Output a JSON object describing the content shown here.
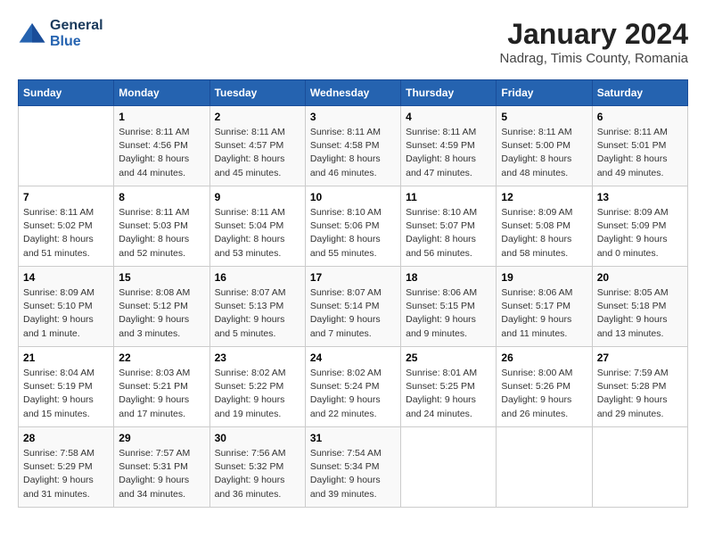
{
  "header": {
    "logo_line1": "General",
    "logo_line2": "Blue",
    "month": "January 2024",
    "location": "Nadrag, Timis County, Romania"
  },
  "weekdays": [
    "Sunday",
    "Monday",
    "Tuesday",
    "Wednesday",
    "Thursday",
    "Friday",
    "Saturday"
  ],
  "weeks": [
    [
      {
        "day": "",
        "sunrise": "",
        "sunset": "",
        "daylight": ""
      },
      {
        "day": "1",
        "sunrise": "Sunrise: 8:11 AM",
        "sunset": "Sunset: 4:56 PM",
        "daylight": "Daylight: 8 hours and 44 minutes."
      },
      {
        "day": "2",
        "sunrise": "Sunrise: 8:11 AM",
        "sunset": "Sunset: 4:57 PM",
        "daylight": "Daylight: 8 hours and 45 minutes."
      },
      {
        "day": "3",
        "sunrise": "Sunrise: 8:11 AM",
        "sunset": "Sunset: 4:58 PM",
        "daylight": "Daylight: 8 hours and 46 minutes."
      },
      {
        "day": "4",
        "sunrise": "Sunrise: 8:11 AM",
        "sunset": "Sunset: 4:59 PM",
        "daylight": "Daylight: 8 hours and 47 minutes."
      },
      {
        "day": "5",
        "sunrise": "Sunrise: 8:11 AM",
        "sunset": "Sunset: 5:00 PM",
        "daylight": "Daylight: 8 hours and 48 minutes."
      },
      {
        "day": "6",
        "sunrise": "Sunrise: 8:11 AM",
        "sunset": "Sunset: 5:01 PM",
        "daylight": "Daylight: 8 hours and 49 minutes."
      }
    ],
    [
      {
        "day": "7",
        "sunrise": "Sunrise: 8:11 AM",
        "sunset": "Sunset: 5:02 PM",
        "daylight": "Daylight: 8 hours and 51 minutes."
      },
      {
        "day": "8",
        "sunrise": "Sunrise: 8:11 AM",
        "sunset": "Sunset: 5:03 PM",
        "daylight": "Daylight: 8 hours and 52 minutes."
      },
      {
        "day": "9",
        "sunrise": "Sunrise: 8:11 AM",
        "sunset": "Sunset: 5:04 PM",
        "daylight": "Daylight: 8 hours and 53 minutes."
      },
      {
        "day": "10",
        "sunrise": "Sunrise: 8:10 AM",
        "sunset": "Sunset: 5:06 PM",
        "daylight": "Daylight: 8 hours and 55 minutes."
      },
      {
        "day": "11",
        "sunrise": "Sunrise: 8:10 AM",
        "sunset": "Sunset: 5:07 PM",
        "daylight": "Daylight: 8 hours and 56 minutes."
      },
      {
        "day": "12",
        "sunrise": "Sunrise: 8:09 AM",
        "sunset": "Sunset: 5:08 PM",
        "daylight": "Daylight: 8 hours and 58 minutes."
      },
      {
        "day": "13",
        "sunrise": "Sunrise: 8:09 AM",
        "sunset": "Sunset: 5:09 PM",
        "daylight": "Daylight: 9 hours and 0 minutes."
      }
    ],
    [
      {
        "day": "14",
        "sunrise": "Sunrise: 8:09 AM",
        "sunset": "Sunset: 5:10 PM",
        "daylight": "Daylight: 9 hours and 1 minute."
      },
      {
        "day": "15",
        "sunrise": "Sunrise: 8:08 AM",
        "sunset": "Sunset: 5:12 PM",
        "daylight": "Daylight: 9 hours and 3 minutes."
      },
      {
        "day": "16",
        "sunrise": "Sunrise: 8:07 AM",
        "sunset": "Sunset: 5:13 PM",
        "daylight": "Daylight: 9 hours and 5 minutes."
      },
      {
        "day": "17",
        "sunrise": "Sunrise: 8:07 AM",
        "sunset": "Sunset: 5:14 PM",
        "daylight": "Daylight: 9 hours and 7 minutes."
      },
      {
        "day": "18",
        "sunrise": "Sunrise: 8:06 AM",
        "sunset": "Sunset: 5:15 PM",
        "daylight": "Daylight: 9 hours and 9 minutes."
      },
      {
        "day": "19",
        "sunrise": "Sunrise: 8:06 AM",
        "sunset": "Sunset: 5:17 PM",
        "daylight": "Daylight: 9 hours and 11 minutes."
      },
      {
        "day": "20",
        "sunrise": "Sunrise: 8:05 AM",
        "sunset": "Sunset: 5:18 PM",
        "daylight": "Daylight: 9 hours and 13 minutes."
      }
    ],
    [
      {
        "day": "21",
        "sunrise": "Sunrise: 8:04 AM",
        "sunset": "Sunset: 5:19 PM",
        "daylight": "Daylight: 9 hours and 15 minutes."
      },
      {
        "day": "22",
        "sunrise": "Sunrise: 8:03 AM",
        "sunset": "Sunset: 5:21 PM",
        "daylight": "Daylight: 9 hours and 17 minutes."
      },
      {
        "day": "23",
        "sunrise": "Sunrise: 8:02 AM",
        "sunset": "Sunset: 5:22 PM",
        "daylight": "Daylight: 9 hours and 19 minutes."
      },
      {
        "day": "24",
        "sunrise": "Sunrise: 8:02 AM",
        "sunset": "Sunset: 5:24 PM",
        "daylight": "Daylight: 9 hours and 22 minutes."
      },
      {
        "day": "25",
        "sunrise": "Sunrise: 8:01 AM",
        "sunset": "Sunset: 5:25 PM",
        "daylight": "Daylight: 9 hours and 24 minutes."
      },
      {
        "day": "26",
        "sunrise": "Sunrise: 8:00 AM",
        "sunset": "Sunset: 5:26 PM",
        "daylight": "Daylight: 9 hours and 26 minutes."
      },
      {
        "day": "27",
        "sunrise": "Sunrise: 7:59 AM",
        "sunset": "Sunset: 5:28 PM",
        "daylight": "Daylight: 9 hours and 29 minutes."
      }
    ],
    [
      {
        "day": "28",
        "sunrise": "Sunrise: 7:58 AM",
        "sunset": "Sunset: 5:29 PM",
        "daylight": "Daylight: 9 hours and 31 minutes."
      },
      {
        "day": "29",
        "sunrise": "Sunrise: 7:57 AM",
        "sunset": "Sunset: 5:31 PM",
        "daylight": "Daylight: 9 hours and 34 minutes."
      },
      {
        "day": "30",
        "sunrise": "Sunrise: 7:56 AM",
        "sunset": "Sunset: 5:32 PM",
        "daylight": "Daylight: 9 hours and 36 minutes."
      },
      {
        "day": "31",
        "sunrise": "Sunrise: 7:54 AM",
        "sunset": "Sunset: 5:34 PM",
        "daylight": "Daylight: 9 hours and 39 minutes."
      },
      {
        "day": "",
        "sunrise": "",
        "sunset": "",
        "daylight": ""
      },
      {
        "day": "",
        "sunrise": "",
        "sunset": "",
        "daylight": ""
      },
      {
        "day": "",
        "sunrise": "",
        "sunset": "",
        "daylight": ""
      }
    ]
  ]
}
